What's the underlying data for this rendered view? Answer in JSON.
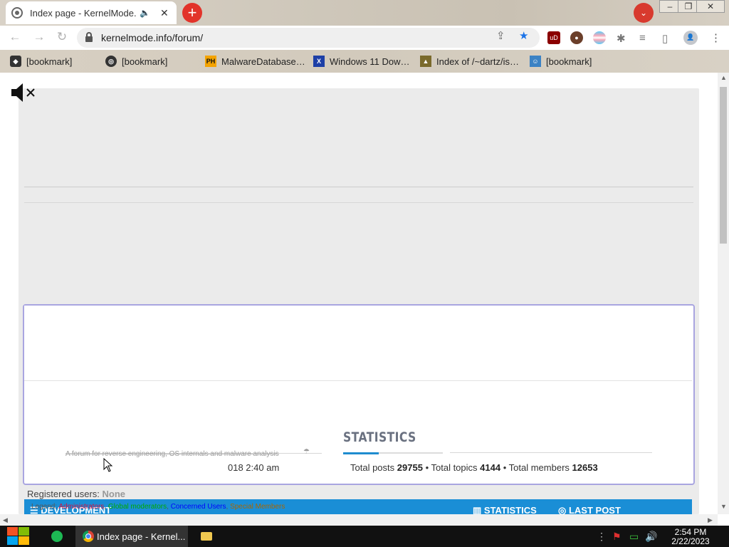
{
  "browser": {
    "tab_title": "Index page - KernelMode.info",
    "url": "kernelmode.info/forum/",
    "window_controls": [
      "minimize",
      "restore",
      "close"
    ]
  },
  "bookmarks": [
    {
      "label": "[bookmark]",
      "icon": "extension-icon"
    },
    {
      "label": "[bookmark]",
      "icon": "globe-icon"
    },
    {
      "label": "MalwareDatabase…",
      "icon": "ph-icon"
    },
    {
      "label": "Windows 11 Dow…",
      "icon": "x-icon"
    },
    {
      "label": "Index of /~dartz/is…",
      "icon": "folder-icon"
    },
    {
      "label": "[bookmark]",
      "icon": "hug-icon"
    }
  ],
  "page": {
    "tagline": "A forum for reverse engineering, OS internals and malware analysis",
    "date_fragment": "018 2:40 am",
    "statistics_heading": "STATISTICS",
    "stats": {
      "posts_label": "Total posts",
      "posts": "29755",
      "topics_label": "Total  topics",
      "topics": "4144",
      "members_label": "Total members",
      "members": "12653"
    },
    "registered_users_label": "Registered users:",
    "registered_users_value": "None",
    "legend": {
      "label": "Legend:",
      "items": [
        {
          "name": "Administrators",
          "color": "#d31141"
        },
        {
          "name": "Global moderators",
          "color": "#00aa00"
        },
        {
          "name": "Concerned Users",
          "color": "#0000ff"
        },
        {
          "name": "Special Members",
          "color": "#aa6600"
        }
      ]
    },
    "forum_bar": {
      "title": "DEVELOPMENT",
      "statistics": "STATISTICS",
      "last_post": "LAST POST",
      "color": "#1a8ed6"
    }
  },
  "taskbar": {
    "active_app": "Index page - Kernel...",
    "time": "2:54 PM",
    "date": "2/22/2023"
  }
}
